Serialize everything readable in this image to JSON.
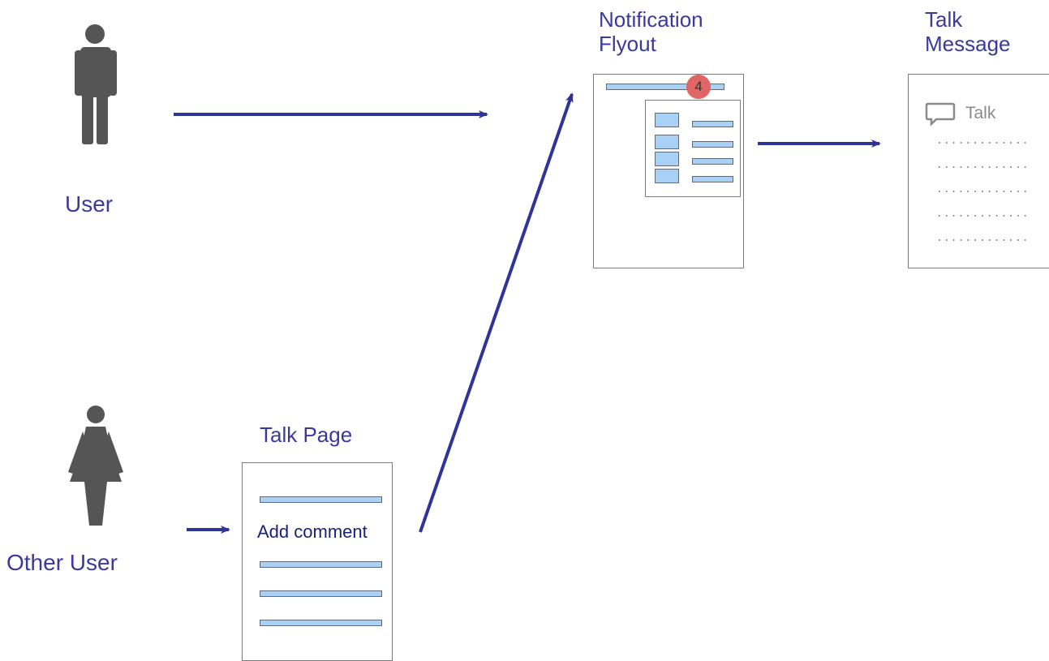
{
  "actors": {
    "user_label": "User",
    "other_user_label": "Other User"
  },
  "notification_flyout": {
    "title": "Notification Flyout",
    "badge_count": "4"
  },
  "talk_message": {
    "title": "Talk Message",
    "heading": "Talk",
    "dotted_lines": [
      ".............",
      ".............",
      ".............",
      ".............",
      "............."
    ]
  },
  "talk_page": {
    "title": "Talk Page",
    "action_label": "Add comment"
  },
  "colors": {
    "label_text": "#3b3a9c",
    "arrow": "#30339a",
    "bar_fill": "#a9d0f5",
    "badge": "#e06666",
    "figure": "#555555"
  }
}
